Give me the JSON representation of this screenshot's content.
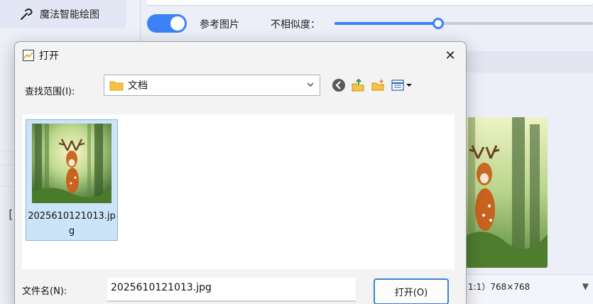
{
  "sidebar": {
    "item_label": "魔法智能绘图",
    "glyph": "[|]"
  },
  "toolbar": {
    "reference_label": "参考图片",
    "reference_on": true,
    "similarity_label": "不相似度：",
    "similarity_value": 0.4
  },
  "preview": {
    "size_label": "1:1）768×768",
    "dropdown_icon": "caret-down-icon"
  },
  "dialog": {
    "title": "打开",
    "close_glyph": "✕",
    "look_in_label": "查找范围(I):",
    "look_in_value": "文档",
    "files": [
      {
        "name": "2025610121013.jpg"
      }
    ],
    "filename_label": "文件名(N):",
    "filename_value": "2025610121013.jpg",
    "open_button": "打开(O)"
  },
  "colors": {
    "accent": "#3b82f6",
    "selection": "#cce4f7",
    "selection_border": "#7eb4ea"
  }
}
